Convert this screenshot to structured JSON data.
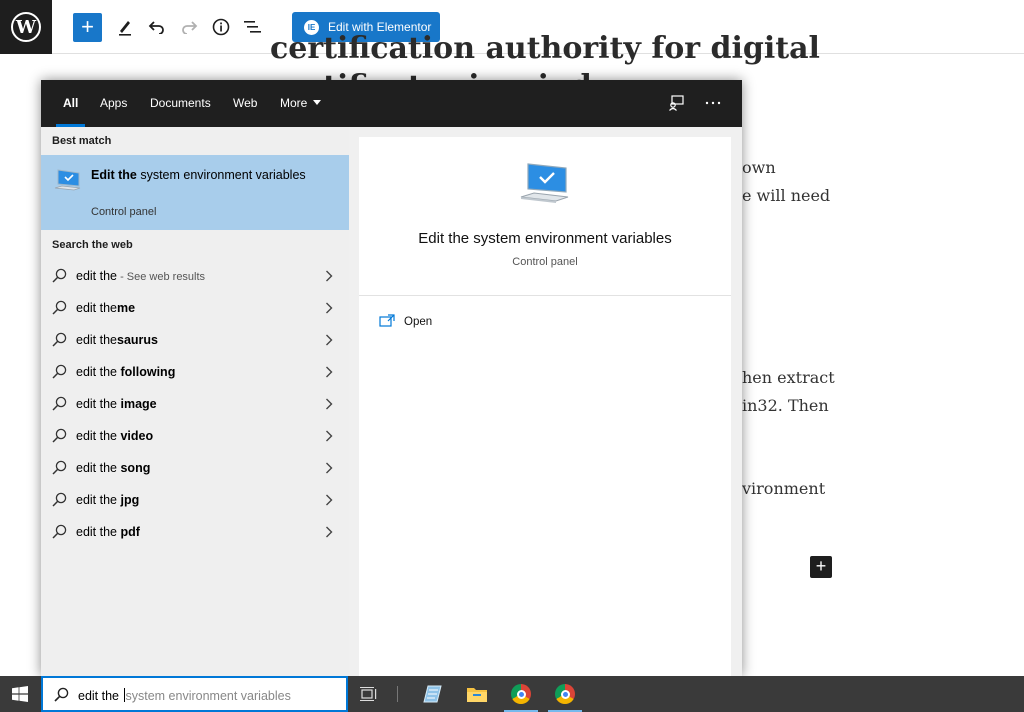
{
  "editor": {
    "elementor_label": "Edit with Elementor",
    "title_lines": [
      "certification authority for digital",
      "certificates in windows"
    ],
    "fragments": [
      "own",
      "e will need",
      "hen extract",
      "in32. Then",
      "vironment"
    ]
  },
  "search": {
    "tabs": [
      "All",
      "Apps",
      "Documents",
      "Web",
      "More"
    ],
    "best_match_label": "Best match",
    "best_match": {
      "title_bold": "Edit the",
      "title_rest": " system environment variables",
      "subtitle": "Control panel"
    },
    "web_label": "Search the web",
    "web_results": [
      {
        "plain": "edit the",
        "bold": "",
        "extra": " - See web results"
      },
      {
        "plain": "edit the",
        "bold": "me",
        "extra": ""
      },
      {
        "plain": "edit the",
        "bold": "saurus",
        "extra": ""
      },
      {
        "plain": "edit the ",
        "bold": "following",
        "extra": ""
      },
      {
        "plain": "edit the ",
        "bold": "image",
        "extra": ""
      },
      {
        "plain": "edit the ",
        "bold": "video",
        "extra": ""
      },
      {
        "plain": "edit the ",
        "bold": "song",
        "extra": ""
      },
      {
        "plain": "edit the ",
        "bold": "jpg",
        "extra": ""
      },
      {
        "plain": "edit the ",
        "bold": "pdf",
        "extra": ""
      }
    ],
    "preview": {
      "title": "Edit the system environment variables",
      "subtitle": "Control panel",
      "action": "Open"
    }
  },
  "taskbar": {
    "typed": "edit the ",
    "suggestion": "system environment variables"
  },
  "colors": {
    "accent": "#0078d7",
    "selection": "#a8cdeb",
    "wp_blue": "#1877c9"
  }
}
